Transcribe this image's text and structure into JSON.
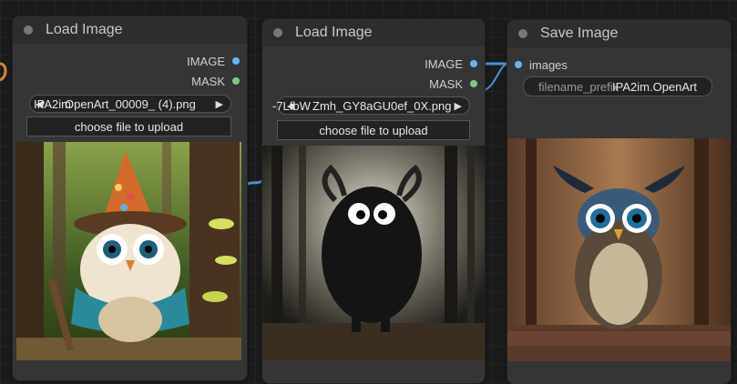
{
  "nodes": {
    "load1": {
      "title": "Load Image",
      "outputs": [
        "IMAGE",
        "MASK"
      ],
      "image_combo": "OpenArt_00009_ (4).png",
      "image_combo_prefix": "IPA2im",
      "upload_label": "choose file to upload"
    },
    "load2": {
      "title": "Load Image",
      "outputs": [
        "IMAGE",
        "MASK"
      ],
      "image_combo": "Zmh_GY8aGU0ef_0X.png",
      "image_combo_prefix": "-7LfbW",
      "upload_label": "choose file to upload"
    },
    "save": {
      "title": "Save Image",
      "input_label": "images",
      "prefix_label": "filename_prefix",
      "prefix_value": "IPA2im.OpenArt"
    }
  },
  "colors": {
    "image_socket": "#64b5f6",
    "mask_socket": "#81c784",
    "link": "#4a90d9"
  },
  "previews": {
    "load1": "owl-wizard-forest-icon",
    "load2": "black-furry-monster-icon",
    "save": "horned-owl-icon"
  }
}
